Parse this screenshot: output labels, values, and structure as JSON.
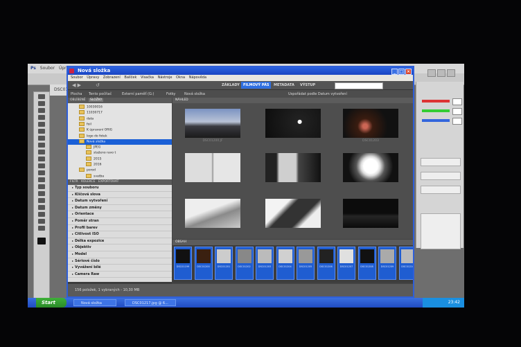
{
  "photoshop": {
    "app_label": "Ps",
    "menu": [
      "Soubor",
      "Úpravy"
    ],
    "document_tab": "DSC01"
  },
  "bridge": {
    "title": "Nová složka",
    "menu": [
      "Soubor",
      "Úpravy",
      "Zobrazení",
      "Balíček",
      "Visačka",
      "Nástroje",
      "Okna",
      "Nápověda"
    ],
    "workspaces": [
      "ZÁKLADY",
      "FILMOVÝ PÁS",
      "METADATA",
      "VÝSTUP"
    ],
    "active_workspace": "FILMOVÝ PÁS",
    "search_placeholder": "",
    "breadcrumb": [
      "Plocha",
      "Tento počítač",
      "Externí paměť (G:)",
      "Fotky",
      "Nová složka"
    ],
    "sort_label": "Uspořádat podle Datum vytvoření",
    "left_tabs": [
      "OBLÍBENÉ",
      "SLOŽKY"
    ],
    "active_left_tab": "SLOŽKY",
    "folders": [
      {
        "label": "10030016",
        "sel": false
      },
      {
        "label": "11030717",
        "sel": false
      },
      {
        "label": "data",
        "sel": false
      },
      {
        "label": "foil",
        "sel": false
      },
      {
        "label": "K úpravení ORIG",
        "sel": false
      },
      {
        "label": "logo do fotek",
        "sel": false
      },
      {
        "label": "Nová složka",
        "sel": true
      },
      {
        "label": "JPEG",
        "sel": false
      },
      {
        "label": "staženo ravo t",
        "sel": false
      },
      {
        "label": "2015",
        "sel": false
      },
      {
        "label": "2016",
        "sel": false
      },
      {
        "label": "porod",
        "sel": false
      },
      {
        "label": "svatba",
        "sel": false
      }
    ],
    "filter_tabs": [
      "FILTR",
      "KOLEKCE",
      "EXPORTOVAT"
    ],
    "filters": [
      "Typ souboru",
      "Klíčová slova",
      "Datum vytvoření",
      "Datum změny",
      "Orientace",
      "Poměr stran",
      "Profil barev",
      "Citlivost ISO",
      "Délka expozice",
      "Objektiv",
      "Model",
      "Sériové číslo",
      "Vyvážení bílé",
      "Camera Raw"
    ],
    "content_header": "NÁHLED",
    "thumbnails": [
      {
        "caption": "DSC01200.JF",
        "tone": "sky"
      },
      {
        "caption": "",
        "tone": "moon"
      },
      {
        "caption": "DSC01203",
        "tone": "night"
      },
      {
        "caption": "",
        "tone": "book"
      },
      {
        "caption": "",
        "tone": "room"
      },
      {
        "caption": "",
        "tone": "lamp"
      },
      {
        "caption": "",
        "tone": "desk"
      },
      {
        "caption": "",
        "tone": "phone"
      },
      {
        "caption": "",
        "tone": "dark"
      }
    ],
    "film_header": "OBSAH",
    "filmstrip": [
      "DSC01199",
      "DSC01200",
      "DSC01201",
      "DSC01202",
      "DSC01203",
      "DSC01204",
      "DSC01205",
      "DSC01206",
      "DSC01207",
      "DSC01208",
      "DSC01209",
      "DSC01210"
    ],
    "status": "156 položek, 1 vybraných - 10,30 MB"
  },
  "taskbar": {
    "start": "Start",
    "items": [
      "Nová složka",
      "DSC01217.jpg @ 6..."
    ],
    "clock": "23:42"
  }
}
